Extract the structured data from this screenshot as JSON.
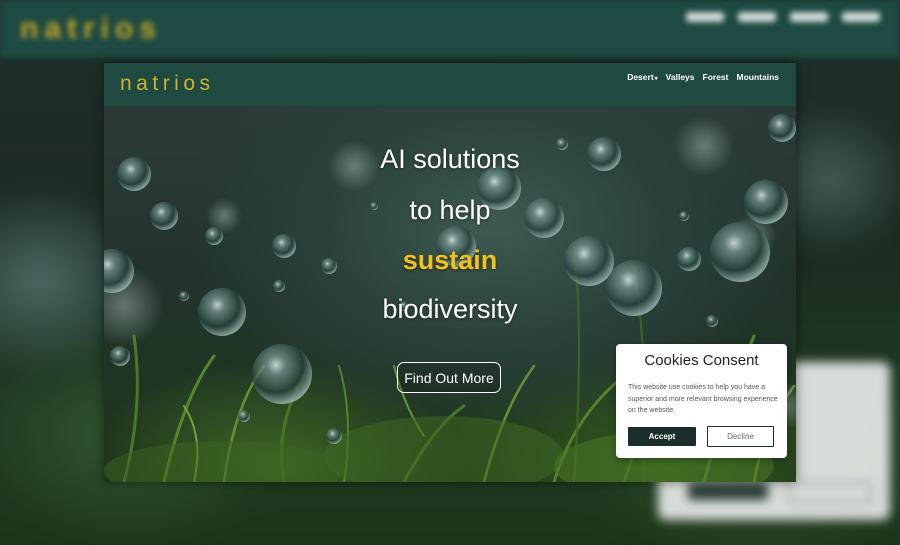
{
  "brand": {
    "logo_text": "natrios",
    "accent_color": "#d2b02b",
    "nav_color": "#1f4a42"
  },
  "nav": {
    "items": [
      {
        "label": "Desert",
        "has_dropdown": true
      },
      {
        "label": "Valleys"
      },
      {
        "label": "Forest"
      },
      {
        "label": "Mountains"
      }
    ],
    "dropdown_icon": "caret-down-icon"
  },
  "hero": {
    "line1": "AI solutions",
    "line2": "to help",
    "line3": "sustain",
    "line4": "biodiversity",
    "highlight_color": "#f2c21b",
    "cta_label": "Find Out More"
  },
  "cookie_consent": {
    "title": "Cookies Consent",
    "text": "This website use cookies to help you have a superior and more relevant browsing experience on the website.",
    "accept_label": "Accept",
    "decline_label": "Decline"
  }
}
